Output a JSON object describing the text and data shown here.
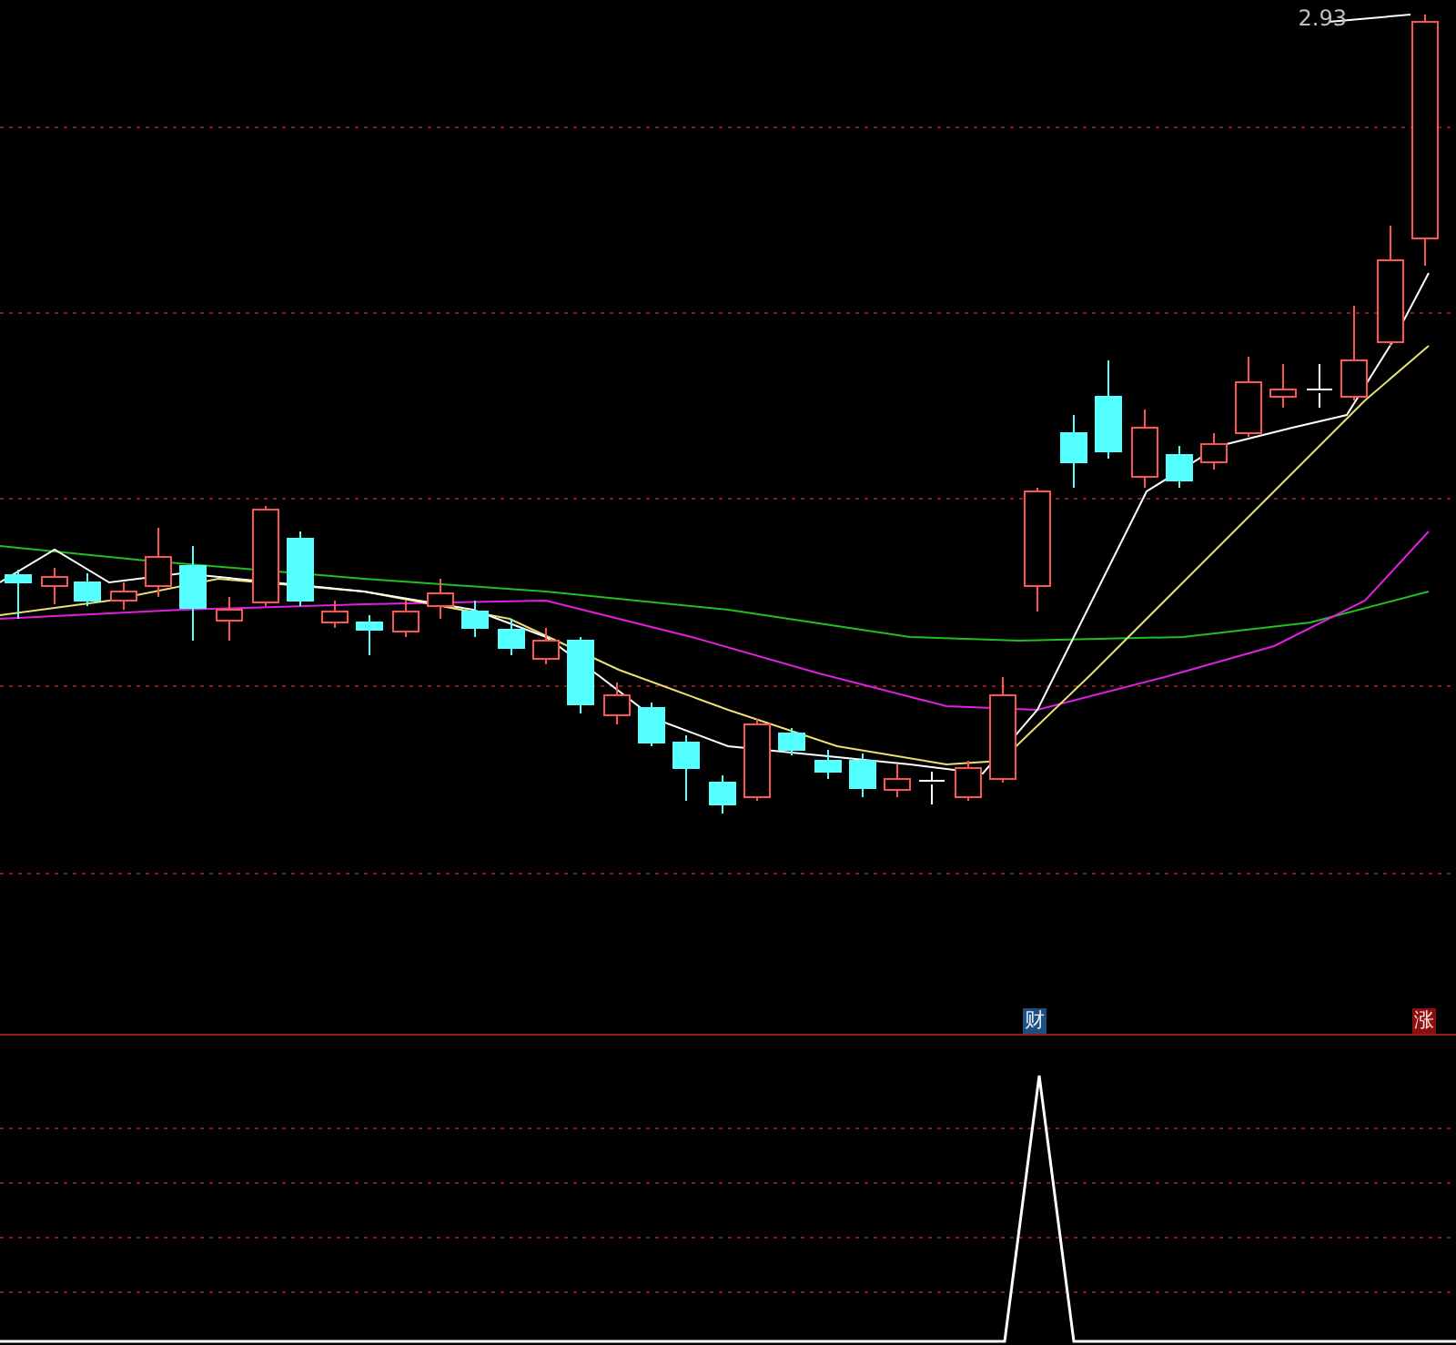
{
  "price_chart": {
    "high_label": "2.93"
  },
  "indicator_panel": {
    "markers": [
      {
        "kind": "fundamental",
        "text": "财"
      },
      {
        "kind": "rise",
        "text": "涨"
      }
    ]
  }
}
